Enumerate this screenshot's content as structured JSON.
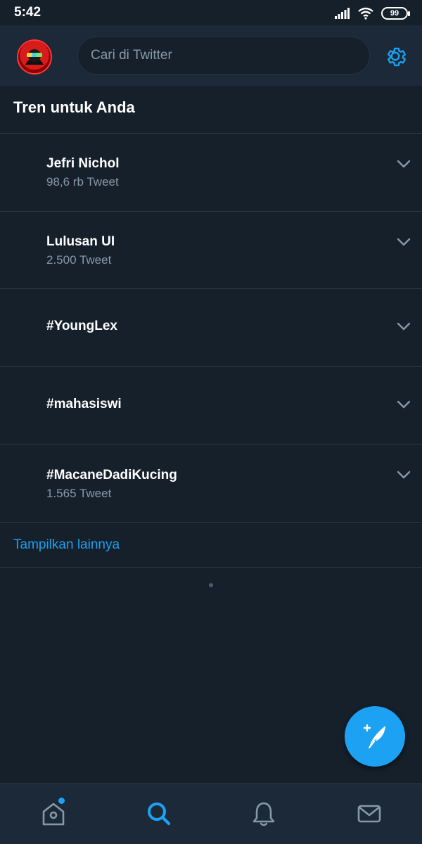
{
  "status_bar": {
    "time": "5:42",
    "battery": "99"
  },
  "header": {
    "search_placeholder": "Cari di Twitter",
    "avatar_icon": "profile-avatar",
    "settings_icon": "gear-icon"
  },
  "section": {
    "title": "Tren untuk Anda"
  },
  "trends": [
    {
      "name": "Jefri Nichol",
      "count": "98,6 rb Tweet"
    },
    {
      "name": "Lulusan UI",
      "count": "2.500 Tweet"
    },
    {
      "name": "#YoungLex",
      "count": ""
    },
    {
      "name": "#mahasiswi",
      "count": ""
    },
    {
      "name": "#MacaneDadiKucing",
      "count": "1.565 Tweet"
    }
  ],
  "show_more": "Tampilkan lainnya",
  "bottom_nav": {
    "items": [
      "home-icon",
      "search-icon",
      "bell-icon",
      "mail-icon"
    ],
    "active": "search-icon"
  },
  "colors": {
    "accent": "#1da1f2",
    "background": "#15202b",
    "bar_background": "#1c2938",
    "secondary_text": "#8899a6"
  }
}
